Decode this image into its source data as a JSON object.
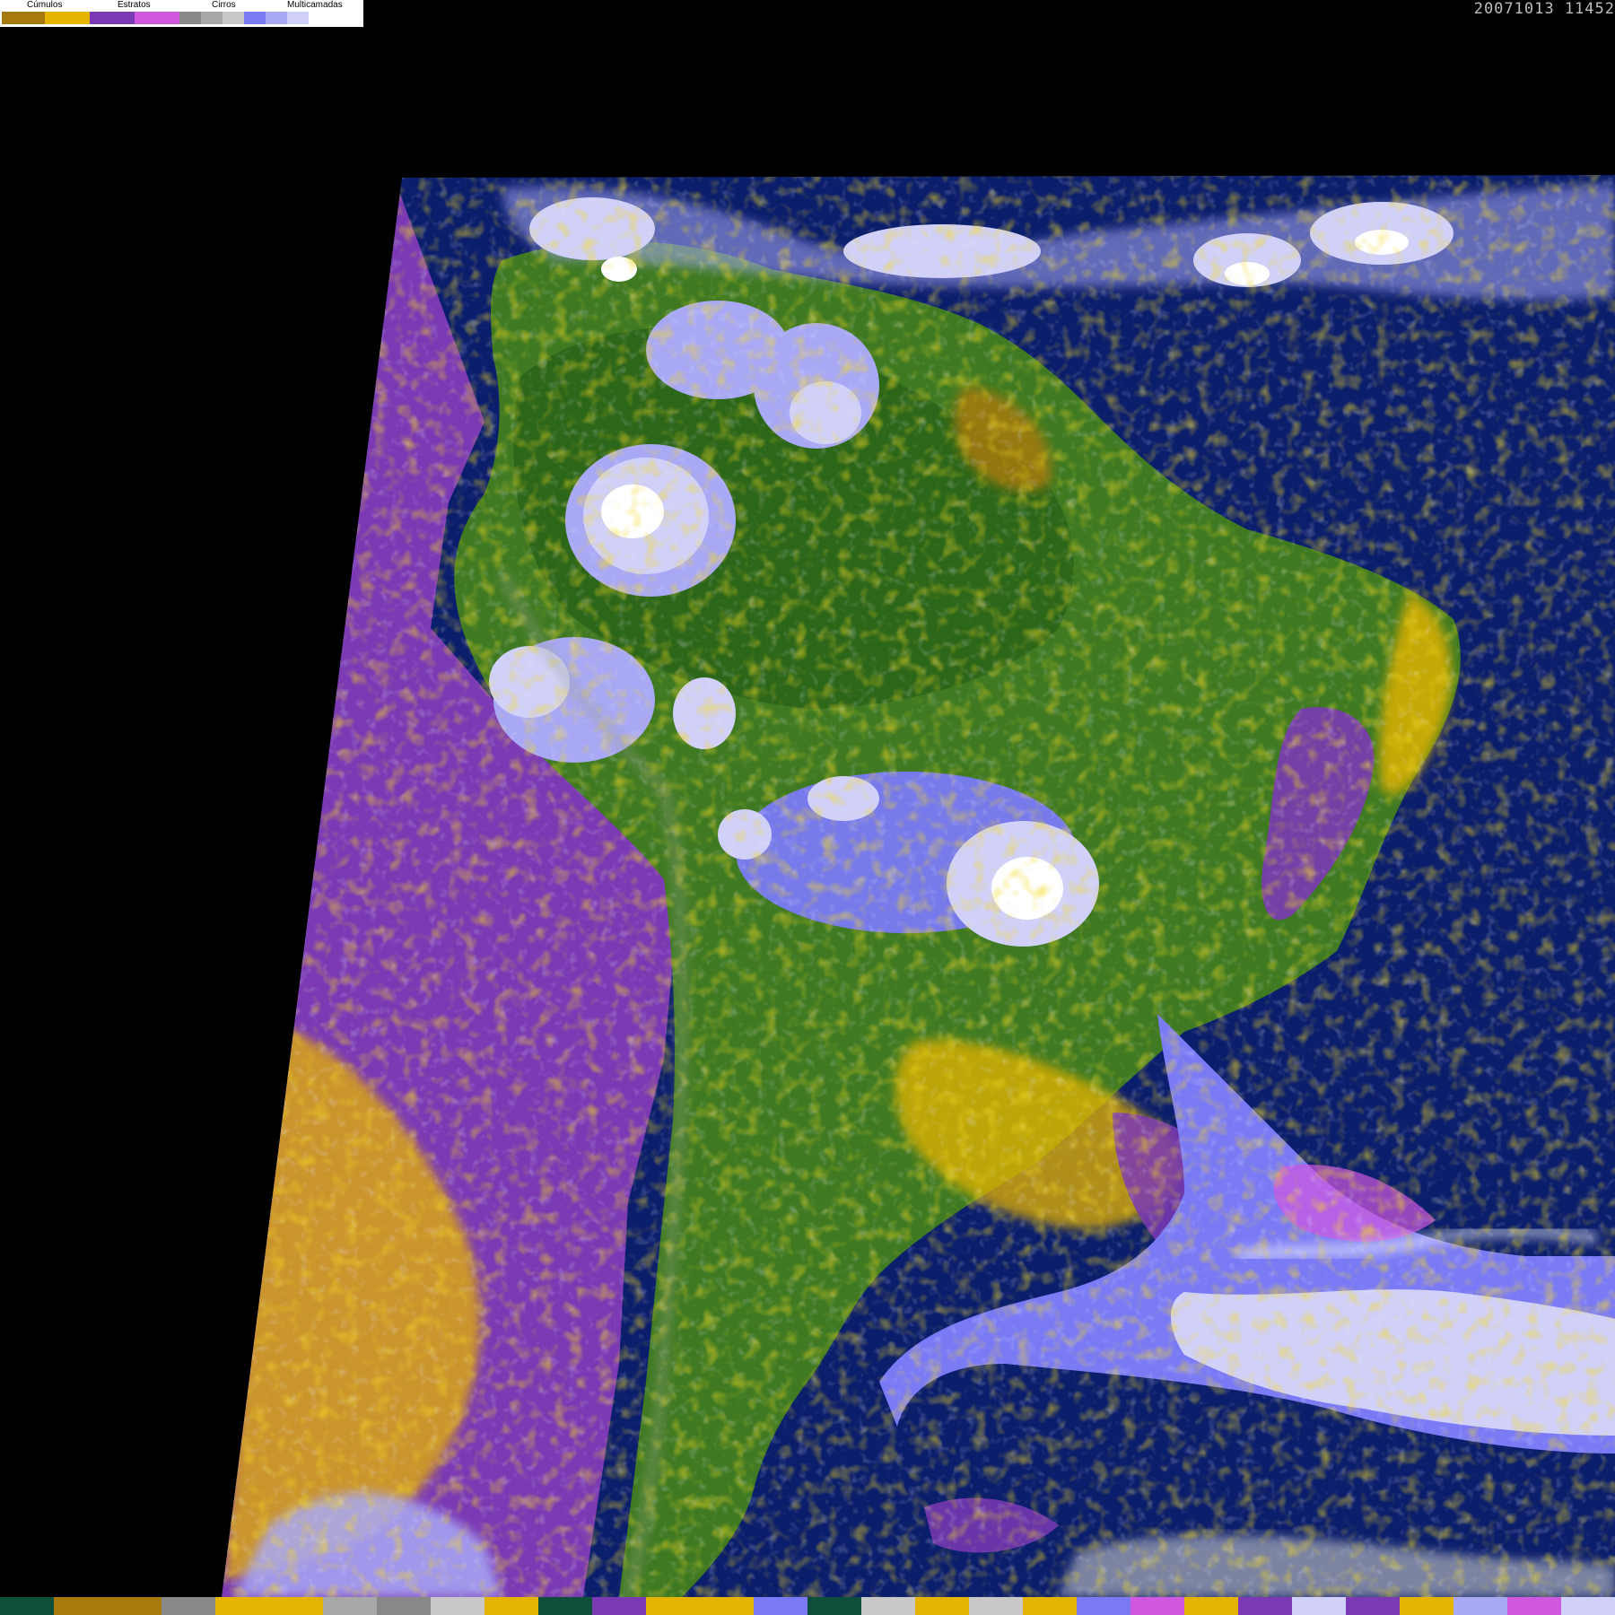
{
  "legend": {
    "groups": [
      {
        "label": "Cúmulos",
        "colors": [
          "#a67a0c",
          "#e6b405"
        ]
      },
      {
        "label": "Estratos",
        "colors": [
          "#7b3ab4",
          "#d057e0"
        ]
      },
      {
        "label": "Cirros",
        "colors": [
          "#888888",
          "#a8a8a8",
          "#c8c8c8"
        ]
      },
      {
        "label": "Multicamadas",
        "colors": [
          "#7a7af5",
          "#a8a8f5",
          "#d0d0f8",
          "#ffffff"
        ]
      }
    ]
  },
  "timestamp": "20071013 11452",
  "map": {
    "colors": {
      "ocean": "#0b1e6b",
      "land": "#3f7a22",
      "forest": "#2a6418",
      "space": "#000000"
    }
  },
  "bottom_strip": {
    "colors": [
      "#0d4f3a",
      "#a67a0c",
      "#a67a0c",
      "#888888",
      "#e6b405",
      "#e6b405",
      "#a8a8a8",
      "#888888",
      "#c8c8c8",
      "#e6b405",
      "#0d4f3a",
      "#7b3ab4",
      "#e6b405",
      "#e6b405",
      "#7a7af5",
      "#0d4f3a",
      "#c8c8c8",
      "#e6b405",
      "#c8c8c8",
      "#e6b405",
      "#7a7af5",
      "#d057e0",
      "#e6b405",
      "#7b3ab4",
      "#d0d0f8",
      "#7b3ab4",
      "#e6b405",
      "#a8a8f5",
      "#d057e0",
      "#d0d0f8"
    ]
  }
}
